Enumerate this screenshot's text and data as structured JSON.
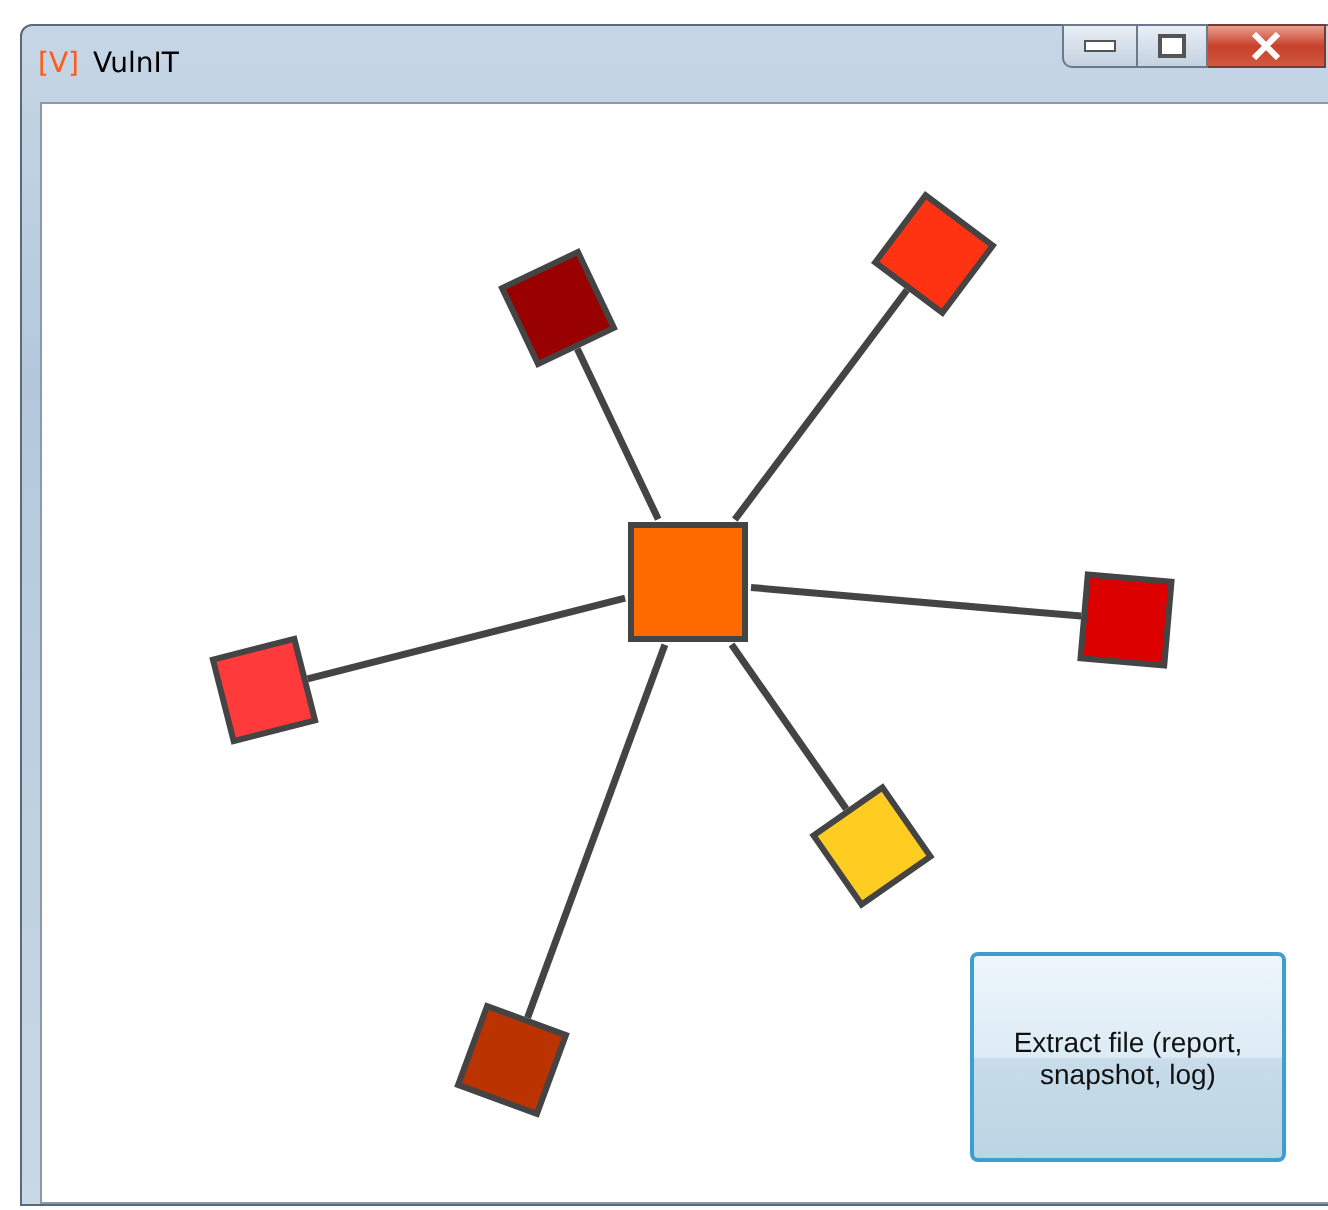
{
  "window": {
    "logo": "[V]",
    "title": "VulnIT"
  },
  "graph": {
    "center": {
      "color": "#ff6a00"
    },
    "nodes": [
      {
        "color": "#990000"
      },
      {
        "color": "#ff3311"
      },
      {
        "color": "#dd0000"
      },
      {
        "color": "#ffcc22"
      },
      {
        "color": "#bb3300"
      },
      {
        "color": "#ff3a3a"
      }
    ]
  },
  "button": {
    "label": "Extract file (report, snapshot, log)"
  }
}
